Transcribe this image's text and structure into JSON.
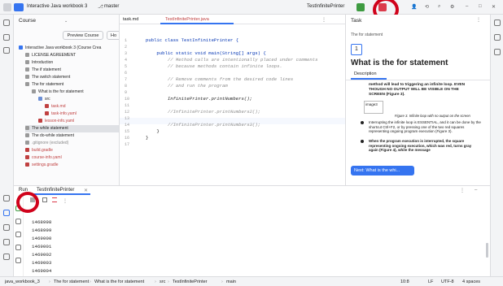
{
  "titlebar": {
    "project": "Interactive Java workbook 3",
    "branch": "master",
    "run_config": "TestInfinitePrinter"
  },
  "course": {
    "title": "Course",
    "preview_button": "Preview Course",
    "h_button": "Ho",
    "items": [
      "Interactive Java workbook 3 (Course Crea",
      "LICENSE AGREEMENT",
      "Introduction",
      "The if statement",
      "The switch statement",
      "The for statement",
      "What is the for statement",
      "src",
      "task.md",
      "task-info.yaml",
      "lesson-info.yaml",
      "The while statement",
      "The do-while statement",
      ".gitignore (excluded)",
      "build.gradle",
      "course-info.yaml",
      "settings.gradle"
    ]
  },
  "editor": {
    "tabs": [
      "task.md",
      "TestInfinitePrinter.java"
    ],
    "lines": [
      "1",
      "2",
      "3",
      "4",
      "5",
      "6",
      "7",
      "8",
      "9",
      "10",
      "11",
      "12",
      "13",
      "14",
      "15",
      "16",
      "17"
    ],
    "code": [
      "public class TestInfinitePrinter {",
      "",
      "    public static void main(String[] args) {",
      "        // Method calls are intentionally placed under comments",
      "        // because methods contain infinite loops.",
      "",
      "        // Remove comments from the desired code lines",
      "        // and run the program",
      "",
      "        InfinitePrinter.printNumbers();",
      "",
      "        //InfinitePrinter.printNumbers2();",
      "",
      "        //InfinitePrinter.printNumbers3();",
      "    }",
      "}",
      ""
    ]
  },
  "task": {
    "header": "Task",
    "subtitle": "The for statement",
    "step": "1",
    "title": "What is the for statement",
    "tab": "Description",
    "text1": "method will lead to triggering an infinite loop. EVEN THOUGH NO OUTPUT WILL BE VISIBLE ON THE SCREEN (Figure 3).",
    "image_label": "image3",
    "caption": "Figure 3. Infinite loop with no output on the screen",
    "bullet1": "Interrupting the infinite loop is ESSENTIAL, and it can be done by the shortcut Ctrl+F2, or by pressing one of the two red squares representing ongoing program execution (Figure 3).",
    "bullet2": "When the program execution is interrupted, the square representing ongoing execution, which was red, turns gray again (Figure 4), while the message",
    "next_button": "Next: What is the whi..."
  },
  "run": {
    "label": "Run",
    "tab": "TestInfinitePrinter",
    "output": [
      "1468998",
      "1468999",
      "1469000",
      "1469001",
      "1469002",
      "1469003",
      "1469004",
      "1469005"
    ]
  },
  "status": {
    "crumbs": [
      "java_workbook_3",
      "The for statement",
      "What is the for statement",
      "src",
      "TestInfinitePrinter",
      "main"
    ],
    "position": "10:8",
    "lf": "LF",
    "encoding": "UTF-8",
    "indent": "4 spaces"
  },
  "colors": {
    "accent": "#3574f0",
    "stop": "#db3b4b",
    "run": "#3e9b41"
  }
}
